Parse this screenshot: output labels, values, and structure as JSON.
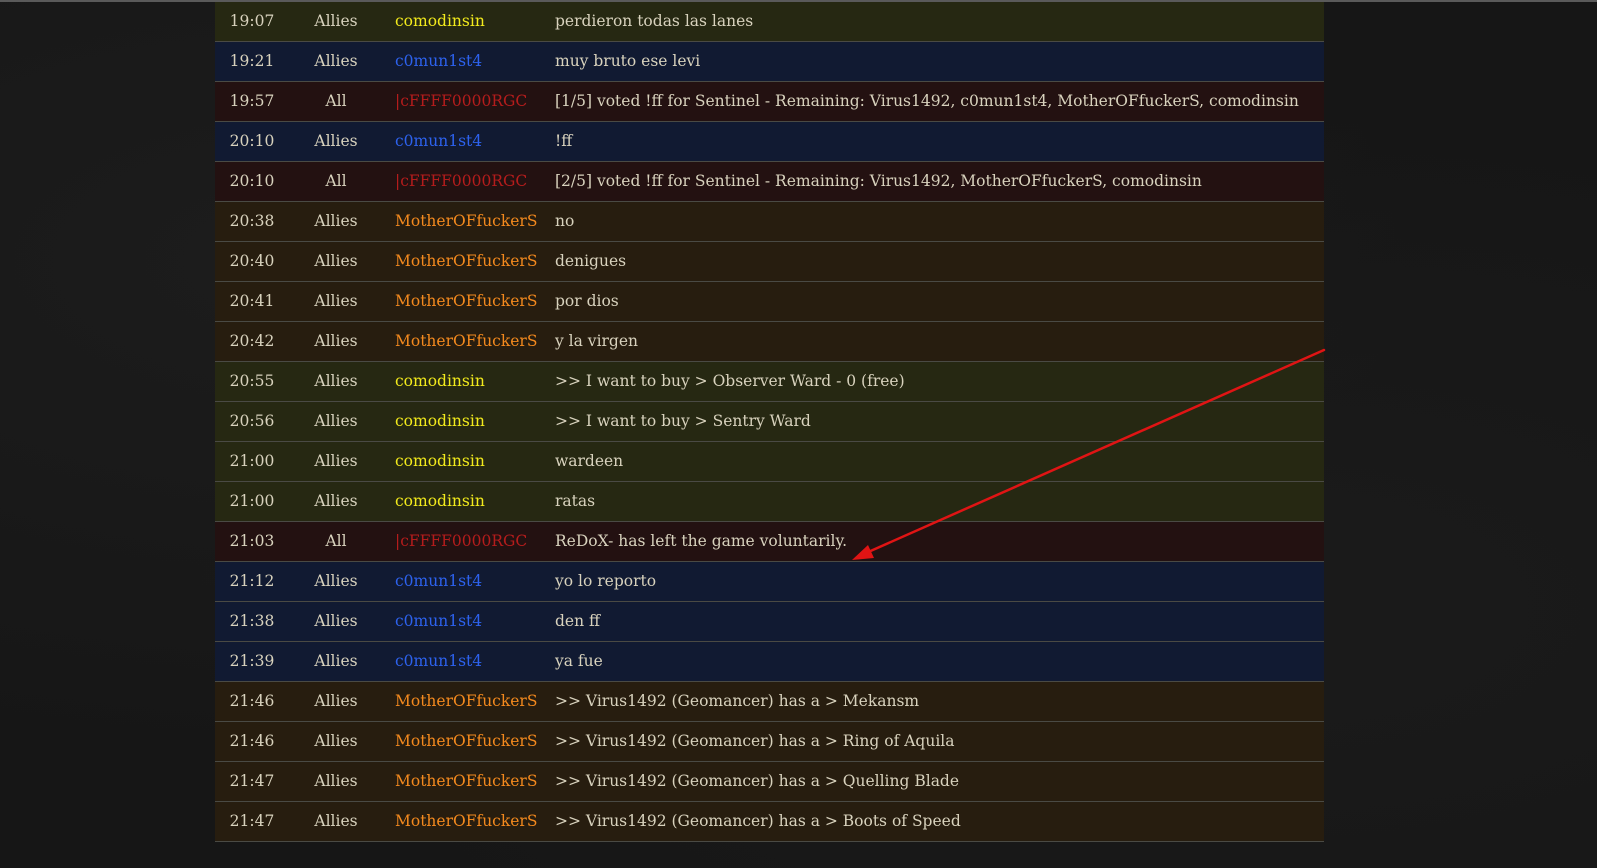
{
  "chat_log": {
    "rows": [
      {
        "time": "19:07",
        "mode": "Allies",
        "player": "comodinsin",
        "message": "perdieron todas las lanes",
        "team_color": "yellow"
      },
      {
        "time": "19:21",
        "mode": "Allies",
        "player": "c0mun1st4",
        "message": "muy bruto ese levi",
        "team_color": "blue"
      },
      {
        "time": "19:57",
        "mode": "All",
        "player": "|cFFFF0000RGC",
        "message": "[1/5] voted !ff for Sentinel - Remaining: Virus1492, c0mun1st4, MotherOFfuckerS, comodinsin",
        "team_color": "red"
      },
      {
        "time": "20:10",
        "mode": "Allies",
        "player": "c0mun1st4",
        "message": "!ff",
        "team_color": "blue"
      },
      {
        "time": "20:10",
        "mode": "All",
        "player": "|cFFFF0000RGC",
        "message": "[2/5] voted !ff for Sentinel - Remaining: Virus1492, MotherOFfuckerS, comodinsin",
        "team_color": "red"
      },
      {
        "time": "20:38",
        "mode": "Allies",
        "player": "MotherOFfuckerS",
        "message": "no",
        "team_color": "orange"
      },
      {
        "time": "20:40",
        "mode": "Allies",
        "player": "MotherOFfuckerS",
        "message": "denigues",
        "team_color": "orange"
      },
      {
        "time": "20:41",
        "mode": "Allies",
        "player": "MotherOFfuckerS",
        "message": "por dios",
        "team_color": "orange"
      },
      {
        "time": "20:42",
        "mode": "Allies",
        "player": "MotherOFfuckerS",
        "message": "y la virgen",
        "team_color": "orange"
      },
      {
        "time": "20:55",
        "mode": "Allies",
        "player": "comodinsin",
        "message": ">> I want to buy > Observer Ward - 0 (free)",
        "team_color": "yellow"
      },
      {
        "time": "20:56",
        "mode": "Allies",
        "player": "comodinsin",
        "message": ">> I want to buy > Sentry Ward",
        "team_color": "yellow"
      },
      {
        "time": "21:00",
        "mode": "Allies",
        "player": "comodinsin",
        "message": "wardeen",
        "team_color": "yellow"
      },
      {
        "time": "21:00",
        "mode": "Allies",
        "player": "comodinsin",
        "message": "ratas",
        "team_color": "yellow"
      },
      {
        "time": "21:03",
        "mode": "All",
        "player": "|cFFFF0000RGC",
        "message": "ReDoX- has left the game voluntarily.",
        "team_color": "red"
      },
      {
        "time": "21:12",
        "mode": "Allies",
        "player": "c0mun1st4",
        "message": "yo lo reporto",
        "team_color": "blue"
      },
      {
        "time": "21:38",
        "mode": "Allies",
        "player": "c0mun1st4",
        "message": "den ff",
        "team_color": "blue"
      },
      {
        "time": "21:39",
        "mode": "Allies",
        "player": "c0mun1st4",
        "message": "ya fue",
        "team_color": "blue"
      },
      {
        "time": "21:46",
        "mode": "Allies",
        "player": "MotherOFfuckerS",
        "message": ">> Virus1492 (Geomancer) has a > Mekansm",
        "team_color": "orange"
      },
      {
        "time": "21:46",
        "mode": "Allies",
        "player": "MotherOFfuckerS",
        "message": ">> Virus1492 (Geomancer) has a > Ring of Aquila",
        "team_color": "orange"
      },
      {
        "time": "21:47",
        "mode": "Allies",
        "player": "MotherOFfuckerS",
        "message": ">> Virus1492 (Geomancer) has a > Quelling Blade",
        "team_color": "orange"
      },
      {
        "time": "21:47",
        "mode": "Allies",
        "player": "MotherOFfuckerS",
        "message": ">> Virus1492 (Geomancer) has a > Boots of Speed",
        "team_color": "orange"
      }
    ]
  },
  "annotation": {
    "arrow_color": "#e01414",
    "arrow_target_row": 13
  }
}
